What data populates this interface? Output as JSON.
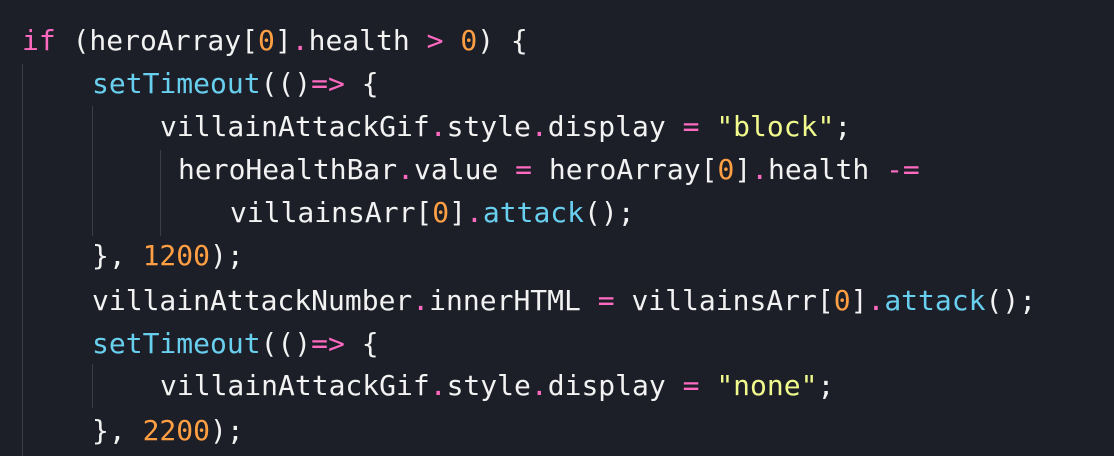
{
  "editor": {
    "theme": {
      "background": "#1d1f28",
      "text": "#f2f2f2",
      "keyword": "#ff6ac1",
      "number": "#ff9f43",
      "function": "#69cfef",
      "string": "#f1fa8c"
    },
    "lines": [
      [
        {
          "t": "if",
          "c": "kw"
        },
        {
          "t": " (heroArray[",
          "c": "plain"
        },
        {
          "t": "0",
          "c": "num"
        },
        {
          "t": "]",
          "c": "plain"
        },
        {
          "t": ".",
          "c": "op"
        },
        {
          "t": "health ",
          "c": "plain"
        },
        {
          "t": ">",
          "c": "op"
        },
        {
          "t": " ",
          "c": "plain"
        },
        {
          "t": "0",
          "c": "num"
        },
        {
          "t": ") {",
          "c": "plain"
        }
      ],
      [
        {
          "t": "setTimeout",
          "c": "fn"
        },
        {
          "t": "(()",
          "c": "plain"
        },
        {
          "t": "=>",
          "c": "op"
        },
        {
          "t": " {",
          "c": "plain"
        }
      ],
      [
        {
          "t": "villainAttackGif",
          "c": "plain"
        },
        {
          "t": ".",
          "c": "op"
        },
        {
          "t": "style",
          "c": "plain"
        },
        {
          "t": ".",
          "c": "op"
        },
        {
          "t": "display ",
          "c": "plain"
        },
        {
          "t": "=",
          "c": "op"
        },
        {
          "t": " ",
          "c": "plain"
        },
        {
          "t": "\"block\"",
          "c": "str"
        },
        {
          "t": ";",
          "c": "plain"
        }
      ],
      [
        {
          "t": "heroHealthBar",
          "c": "plain"
        },
        {
          "t": ".",
          "c": "op"
        },
        {
          "t": "value ",
          "c": "plain"
        },
        {
          "t": "=",
          "c": "op"
        },
        {
          "t": " heroArray[",
          "c": "plain"
        },
        {
          "t": "0",
          "c": "num"
        },
        {
          "t": "]",
          "c": "plain"
        },
        {
          "t": ".",
          "c": "op"
        },
        {
          "t": "health ",
          "c": "plain"
        },
        {
          "t": "-=",
          "c": "op"
        }
      ],
      [
        {
          "t": "villainsArr[",
          "c": "plain"
        },
        {
          "t": "0",
          "c": "num"
        },
        {
          "t": "]",
          "c": "plain"
        },
        {
          "t": ".",
          "c": "op"
        },
        {
          "t": "attack",
          "c": "fn"
        },
        {
          "t": "();",
          "c": "plain"
        }
      ],
      [
        {
          "t": "}, ",
          "c": "plain"
        },
        {
          "t": "1200",
          "c": "num"
        },
        {
          "t": ");",
          "c": "plain"
        }
      ],
      [
        {
          "t": "villainAttackNumber",
          "c": "plain"
        },
        {
          "t": ".",
          "c": "op"
        },
        {
          "t": "innerHTML ",
          "c": "plain"
        },
        {
          "t": "=",
          "c": "op"
        },
        {
          "t": " villainsArr[",
          "c": "plain"
        },
        {
          "t": "0",
          "c": "num"
        },
        {
          "t": "]",
          "c": "plain"
        },
        {
          "t": ".",
          "c": "op"
        },
        {
          "t": "attack",
          "c": "fn"
        },
        {
          "t": "();",
          "c": "plain"
        }
      ],
      [
        {
          "t": "setTimeout",
          "c": "fn"
        },
        {
          "t": "(()",
          "c": "plain"
        },
        {
          "t": "=>",
          "c": "op"
        },
        {
          "t": " {",
          "c": "plain"
        }
      ],
      [
        {
          "t": "villainAttackGif",
          "c": "plain"
        },
        {
          "t": ".",
          "c": "op"
        },
        {
          "t": "style",
          "c": "plain"
        },
        {
          "t": ".",
          "c": "op"
        },
        {
          "t": "display ",
          "c": "plain"
        },
        {
          "t": "=",
          "c": "op"
        },
        {
          "t": " ",
          "c": "plain"
        },
        {
          "t": "\"none\"",
          "c": "str"
        },
        {
          "t": ";",
          "c": "plain"
        }
      ],
      [
        {
          "t": "}, ",
          "c": "plain"
        },
        {
          "t": "2200",
          "c": "num"
        },
        {
          "t": ");",
          "c": "plain"
        }
      ]
    ]
  }
}
